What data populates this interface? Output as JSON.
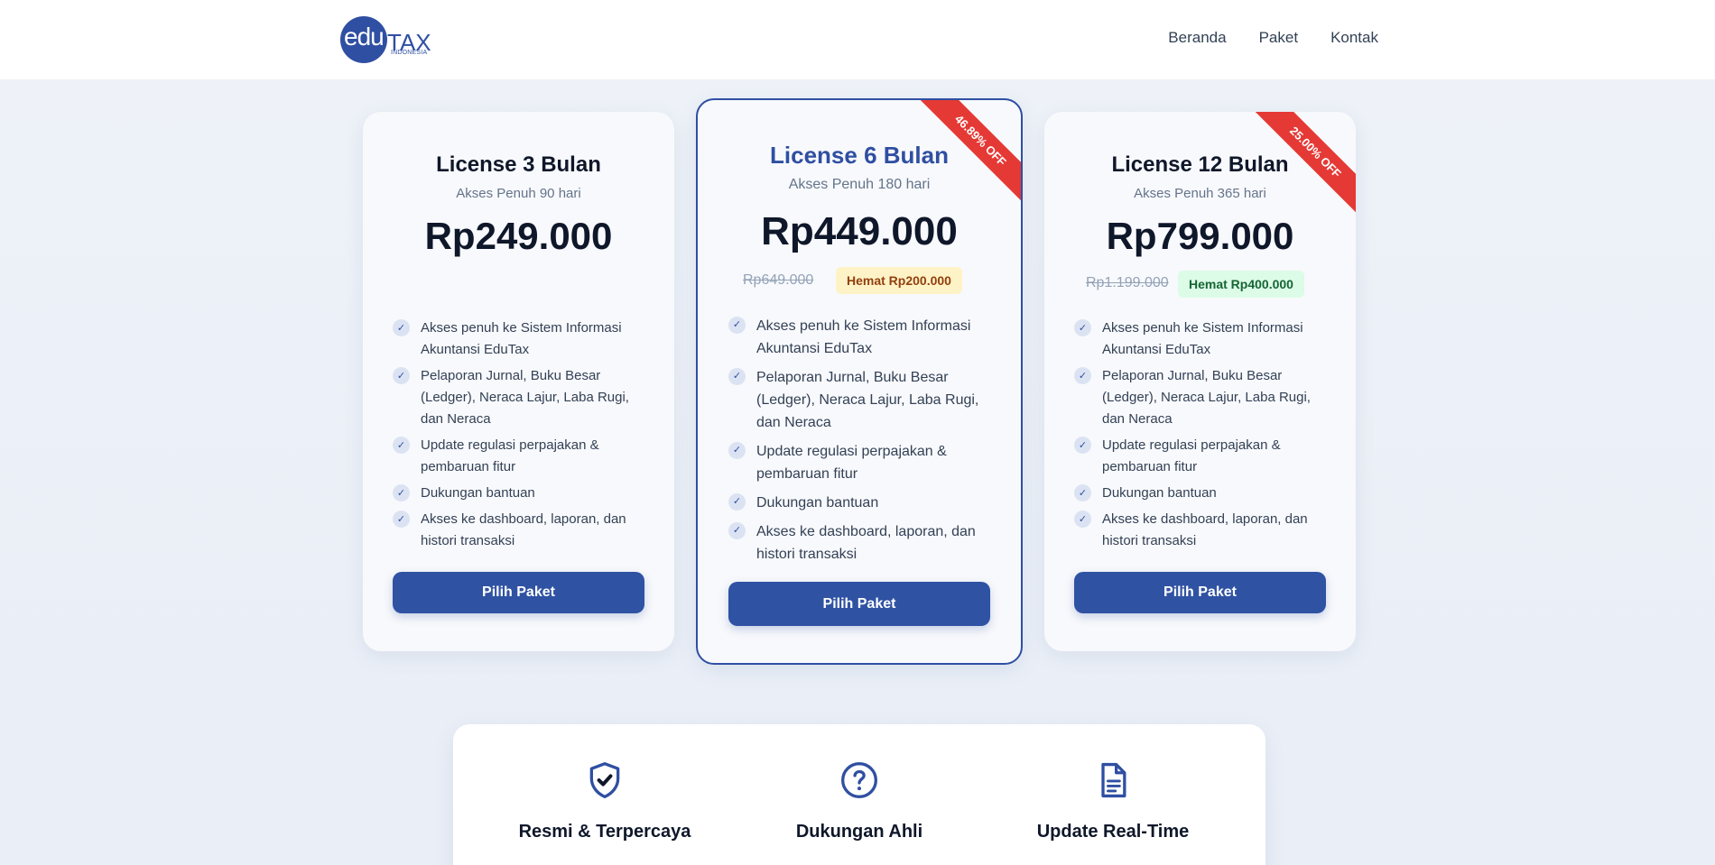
{
  "brand": {
    "logo_edu": "edu",
    "logo_tax": "TAX",
    "logo_sub": "INDONESIA"
  },
  "nav": {
    "items": [
      "Beranda",
      "Paket",
      "Kontak"
    ]
  },
  "plans": [
    {
      "title": "License 3 Bulan",
      "subtitle": "Akses Penuh 90 hari",
      "price": "Rp249.000",
      "features": [
        "Akses penuh ke Sistem Informasi Akuntansi EduTax",
        "Pelaporan Jurnal, Buku Besar (Ledger), Neraca Lajur, Laba Rugi, dan Neraca",
        "Update regulasi perpajakan & pembaruan fitur",
        "Dukungan bantuan",
        "Akses ke dashboard, laporan, dan histori transaksi"
      ],
      "button": "Pilih Paket"
    },
    {
      "title": "License 6 Bulan",
      "subtitle": "Akses Penuh 180 hari",
      "price": "Rp449.000",
      "original_price": "Rp649.000",
      "savings": "Hemat Rp200.000",
      "ribbon": "46.89% OFF",
      "features": [
        "Akses penuh ke Sistem Informasi Akuntansi EduTax",
        "Pelaporan Jurnal, Buku Besar (Ledger), Neraca Lajur, Laba Rugi, dan Neraca",
        "Update regulasi perpajakan & pembaruan fitur",
        "Dukungan bantuan",
        "Akses ke dashboard, laporan, dan histori transaksi"
      ],
      "button": "Pilih Paket"
    },
    {
      "title": "License 12 Bulan",
      "subtitle": "Akses Penuh 365 hari",
      "price": "Rp799.000",
      "original_price": "Rp1.199.000",
      "savings": "Hemat Rp400.000",
      "ribbon": "25.00% OFF",
      "features": [
        "Akses penuh ke Sistem Informasi Akuntansi EduTax",
        "Pelaporan Jurnal, Buku Besar (Ledger), Neraca Lajur, Laba Rugi, dan Neraca",
        "Update regulasi perpajakan & pembaruan fitur",
        "Dukungan bantuan",
        "Akses ke dashboard, laporan, dan histori transaksi"
      ],
      "button": "Pilih Paket"
    }
  ],
  "benefits": [
    {
      "icon": "shield-check-icon",
      "label": "Resmi & Terpercaya"
    },
    {
      "icon": "question-circle-icon",
      "label": "Dukungan Ahli"
    },
    {
      "icon": "document-icon",
      "label": "Update Real-Time"
    }
  ],
  "colors": {
    "primary": "#2f52a3",
    "ribbon": "#e53935",
    "savings_yellow": "#fef3c7",
    "savings_green": "#dcfce7"
  }
}
